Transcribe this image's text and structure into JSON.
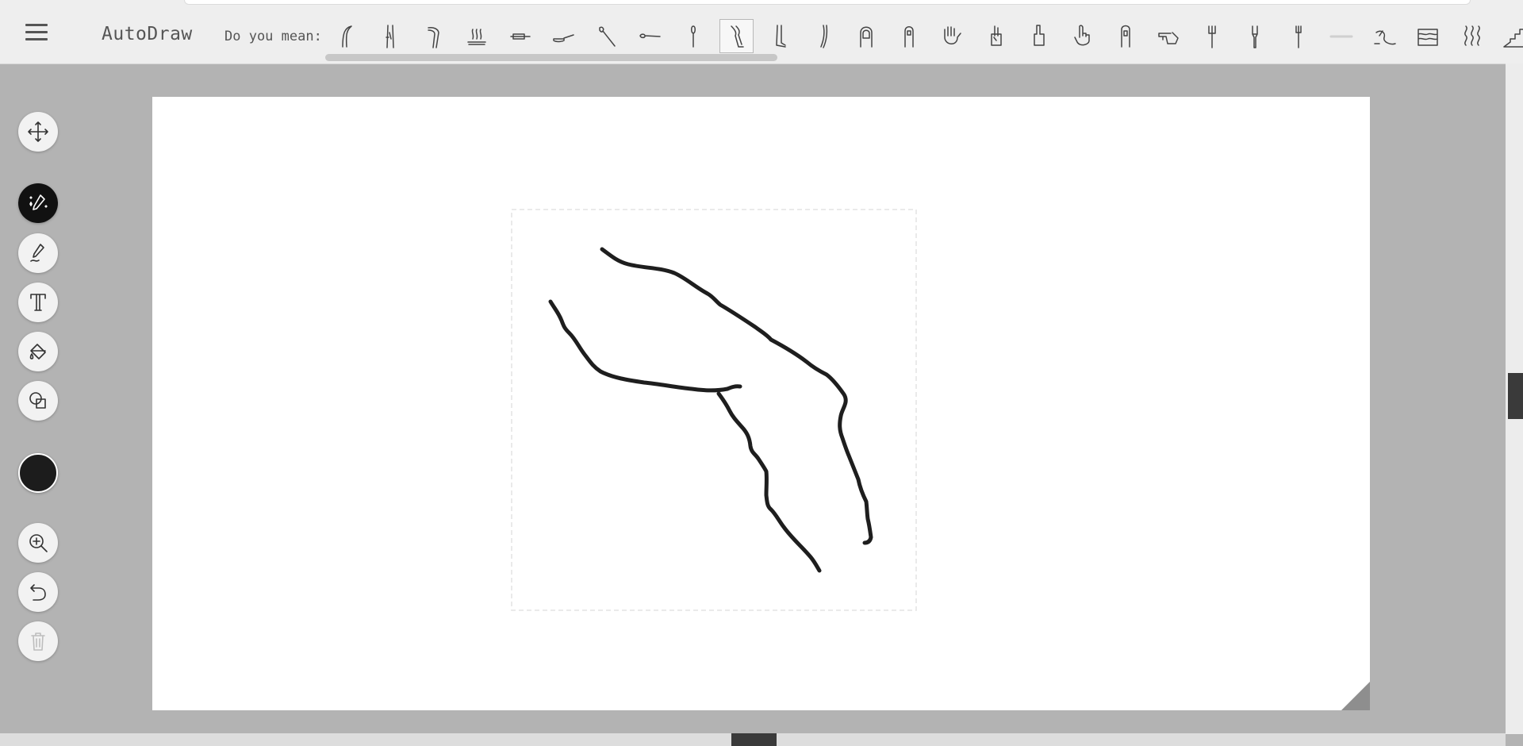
{
  "header": {
    "app_title": "AutoDraw",
    "suggest_label": "Do you mean:",
    "suggestions": [
      {
        "icon": "arm-bent-icon"
      },
      {
        "icon": "legs-icon"
      },
      {
        "icon": "knee-icon"
      },
      {
        "icon": "frying-pan-steam-icon"
      },
      {
        "icon": "pan-icon"
      },
      {
        "icon": "saucepan-icon"
      },
      {
        "icon": "spoon-icon"
      },
      {
        "icon": "ladle-icon"
      },
      {
        "icon": "spoon-upright-icon"
      },
      {
        "icon": "leg-icon",
        "selected": true
      },
      {
        "icon": "boot-icon"
      },
      {
        "icon": "single-leg-icon"
      },
      {
        "icon": "finger-nail-icon"
      },
      {
        "icon": "finger-icon"
      },
      {
        "icon": "hand-open-icon"
      },
      {
        "icon": "hand-index-icon"
      },
      {
        "icon": "pointing-finger-icon"
      },
      {
        "icon": "hand-pointer-icon"
      },
      {
        "icon": "thumb-icon"
      },
      {
        "icon": "hand-point-side-icon"
      },
      {
        "icon": "fork-icon"
      },
      {
        "icon": "fork-small-icon"
      },
      {
        "icon": "fork-thin-icon"
      },
      {
        "icon": "line-icon"
      },
      {
        "icon": "slide-icon"
      },
      {
        "icon": "water-icon"
      },
      {
        "icon": "waves-icon"
      },
      {
        "icon": "stairs-icon"
      }
    ]
  },
  "tools": {
    "move": {
      "icon": "move-icon"
    },
    "autodraw": {
      "icon": "autodraw-icon",
      "active": true
    },
    "draw": {
      "icon": "pencil-icon"
    },
    "type": {
      "icon": "text-icon"
    },
    "fill": {
      "icon": "fill-bucket-icon"
    },
    "shape": {
      "icon": "shape-icon"
    },
    "color": "#1c1c1c",
    "zoom": {
      "icon": "zoom-in-icon"
    },
    "undo": {
      "icon": "undo-icon"
    },
    "delete": {
      "icon": "trash-icon",
      "disabled": true
    }
  }
}
